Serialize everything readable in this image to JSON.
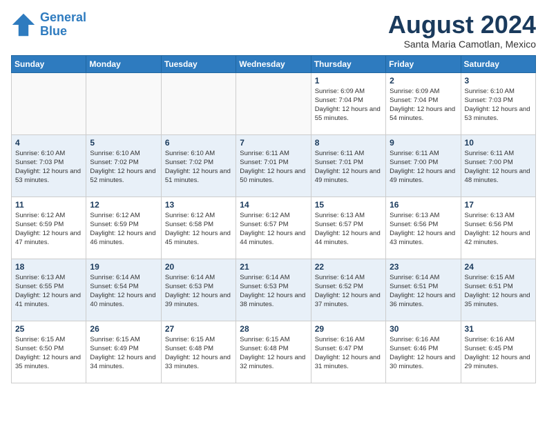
{
  "header": {
    "logo_line1": "General",
    "logo_line2": "Blue",
    "month_title": "August 2024",
    "location": "Santa Maria Camotlan, Mexico"
  },
  "days_of_week": [
    "Sunday",
    "Monday",
    "Tuesday",
    "Wednesday",
    "Thursday",
    "Friday",
    "Saturday"
  ],
  "weeks": [
    [
      {
        "day": "",
        "info": ""
      },
      {
        "day": "",
        "info": ""
      },
      {
        "day": "",
        "info": ""
      },
      {
        "day": "",
        "info": ""
      },
      {
        "day": "1",
        "info": "Sunrise: 6:09 AM\nSunset: 7:04 PM\nDaylight: 12 hours\nand 55 minutes."
      },
      {
        "day": "2",
        "info": "Sunrise: 6:09 AM\nSunset: 7:04 PM\nDaylight: 12 hours\nand 54 minutes."
      },
      {
        "day": "3",
        "info": "Sunrise: 6:10 AM\nSunset: 7:03 PM\nDaylight: 12 hours\nand 53 minutes."
      }
    ],
    [
      {
        "day": "4",
        "info": "Sunrise: 6:10 AM\nSunset: 7:03 PM\nDaylight: 12 hours\nand 53 minutes."
      },
      {
        "day": "5",
        "info": "Sunrise: 6:10 AM\nSunset: 7:02 PM\nDaylight: 12 hours\nand 52 minutes."
      },
      {
        "day": "6",
        "info": "Sunrise: 6:10 AM\nSunset: 7:02 PM\nDaylight: 12 hours\nand 51 minutes."
      },
      {
        "day": "7",
        "info": "Sunrise: 6:11 AM\nSunset: 7:01 PM\nDaylight: 12 hours\nand 50 minutes."
      },
      {
        "day": "8",
        "info": "Sunrise: 6:11 AM\nSunset: 7:01 PM\nDaylight: 12 hours\nand 49 minutes."
      },
      {
        "day": "9",
        "info": "Sunrise: 6:11 AM\nSunset: 7:00 PM\nDaylight: 12 hours\nand 49 minutes."
      },
      {
        "day": "10",
        "info": "Sunrise: 6:11 AM\nSunset: 7:00 PM\nDaylight: 12 hours\nand 48 minutes."
      }
    ],
    [
      {
        "day": "11",
        "info": "Sunrise: 6:12 AM\nSunset: 6:59 PM\nDaylight: 12 hours\nand 47 minutes."
      },
      {
        "day": "12",
        "info": "Sunrise: 6:12 AM\nSunset: 6:59 PM\nDaylight: 12 hours\nand 46 minutes."
      },
      {
        "day": "13",
        "info": "Sunrise: 6:12 AM\nSunset: 6:58 PM\nDaylight: 12 hours\nand 45 minutes."
      },
      {
        "day": "14",
        "info": "Sunrise: 6:12 AM\nSunset: 6:57 PM\nDaylight: 12 hours\nand 44 minutes."
      },
      {
        "day": "15",
        "info": "Sunrise: 6:13 AM\nSunset: 6:57 PM\nDaylight: 12 hours\nand 44 minutes."
      },
      {
        "day": "16",
        "info": "Sunrise: 6:13 AM\nSunset: 6:56 PM\nDaylight: 12 hours\nand 43 minutes."
      },
      {
        "day": "17",
        "info": "Sunrise: 6:13 AM\nSunset: 6:56 PM\nDaylight: 12 hours\nand 42 minutes."
      }
    ],
    [
      {
        "day": "18",
        "info": "Sunrise: 6:13 AM\nSunset: 6:55 PM\nDaylight: 12 hours\nand 41 minutes."
      },
      {
        "day": "19",
        "info": "Sunrise: 6:14 AM\nSunset: 6:54 PM\nDaylight: 12 hours\nand 40 minutes."
      },
      {
        "day": "20",
        "info": "Sunrise: 6:14 AM\nSunset: 6:53 PM\nDaylight: 12 hours\nand 39 minutes."
      },
      {
        "day": "21",
        "info": "Sunrise: 6:14 AM\nSunset: 6:53 PM\nDaylight: 12 hours\nand 38 minutes."
      },
      {
        "day": "22",
        "info": "Sunrise: 6:14 AM\nSunset: 6:52 PM\nDaylight: 12 hours\nand 37 minutes."
      },
      {
        "day": "23",
        "info": "Sunrise: 6:14 AM\nSunset: 6:51 PM\nDaylight: 12 hours\nand 36 minutes."
      },
      {
        "day": "24",
        "info": "Sunrise: 6:15 AM\nSunset: 6:51 PM\nDaylight: 12 hours\nand 35 minutes."
      }
    ],
    [
      {
        "day": "25",
        "info": "Sunrise: 6:15 AM\nSunset: 6:50 PM\nDaylight: 12 hours\nand 35 minutes."
      },
      {
        "day": "26",
        "info": "Sunrise: 6:15 AM\nSunset: 6:49 PM\nDaylight: 12 hours\nand 34 minutes."
      },
      {
        "day": "27",
        "info": "Sunrise: 6:15 AM\nSunset: 6:48 PM\nDaylight: 12 hours\nand 33 minutes."
      },
      {
        "day": "28",
        "info": "Sunrise: 6:15 AM\nSunset: 6:48 PM\nDaylight: 12 hours\nand 32 minutes."
      },
      {
        "day": "29",
        "info": "Sunrise: 6:16 AM\nSunset: 6:47 PM\nDaylight: 12 hours\nand 31 minutes."
      },
      {
        "day": "30",
        "info": "Sunrise: 6:16 AM\nSunset: 6:46 PM\nDaylight: 12 hours\nand 30 minutes."
      },
      {
        "day": "31",
        "info": "Sunrise: 6:16 AM\nSunset: 6:45 PM\nDaylight: 12 hours\nand 29 minutes."
      }
    ]
  ]
}
